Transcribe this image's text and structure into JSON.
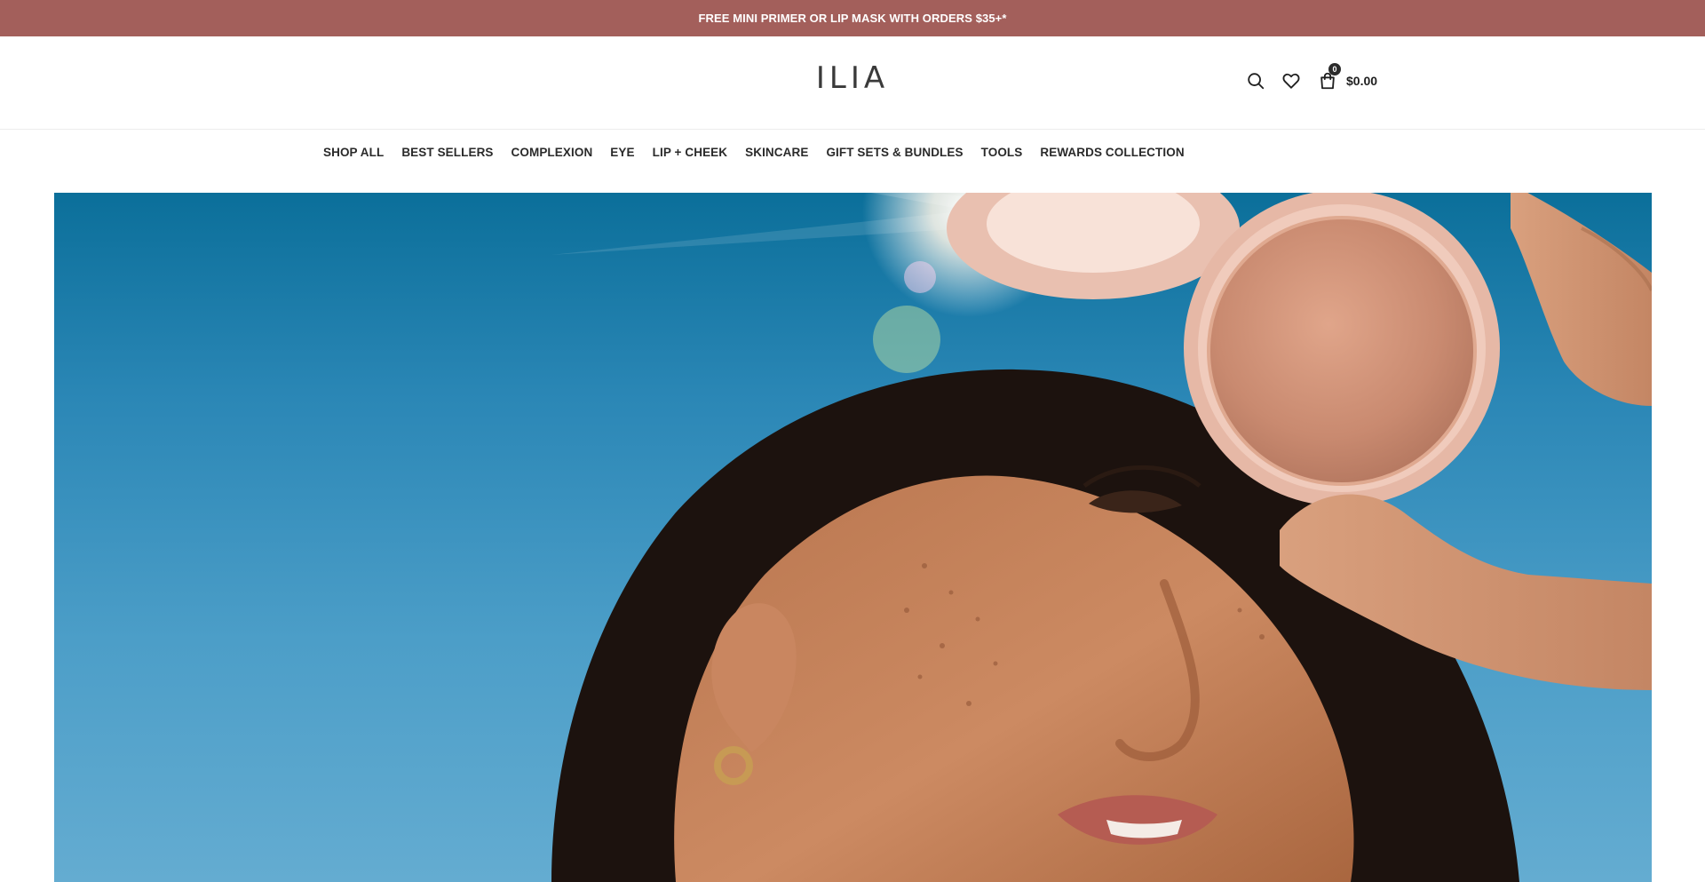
{
  "promo": {
    "text": "FREE MINI PRIMER OR LIP MASK WITH ORDERS $35+*"
  },
  "header": {
    "logo": "ILIA",
    "icons": [
      "search-icon",
      "heart-icon",
      "shopping-bag-icon"
    ],
    "cart": {
      "count": "0",
      "total": "$0.00"
    }
  },
  "nav": {
    "items": [
      {
        "label": "SHOP ALL"
      },
      {
        "label": "BEST SELLERS"
      },
      {
        "label": "COMPLEXION"
      },
      {
        "label": "EYE"
      },
      {
        "label": "LIP + CHEEK"
      },
      {
        "label": "SKINCARE"
      },
      {
        "label": "GIFT SETS & BUNDLES"
      },
      {
        "label": "TOOLS"
      },
      {
        "label": "REWARDS COLLECTION"
      }
    ]
  },
  "colors": {
    "promo_bg": "#a35f5b",
    "sky": "#2b87b6",
    "compact": "#e9c0b0",
    "powder": "#c98a70"
  }
}
